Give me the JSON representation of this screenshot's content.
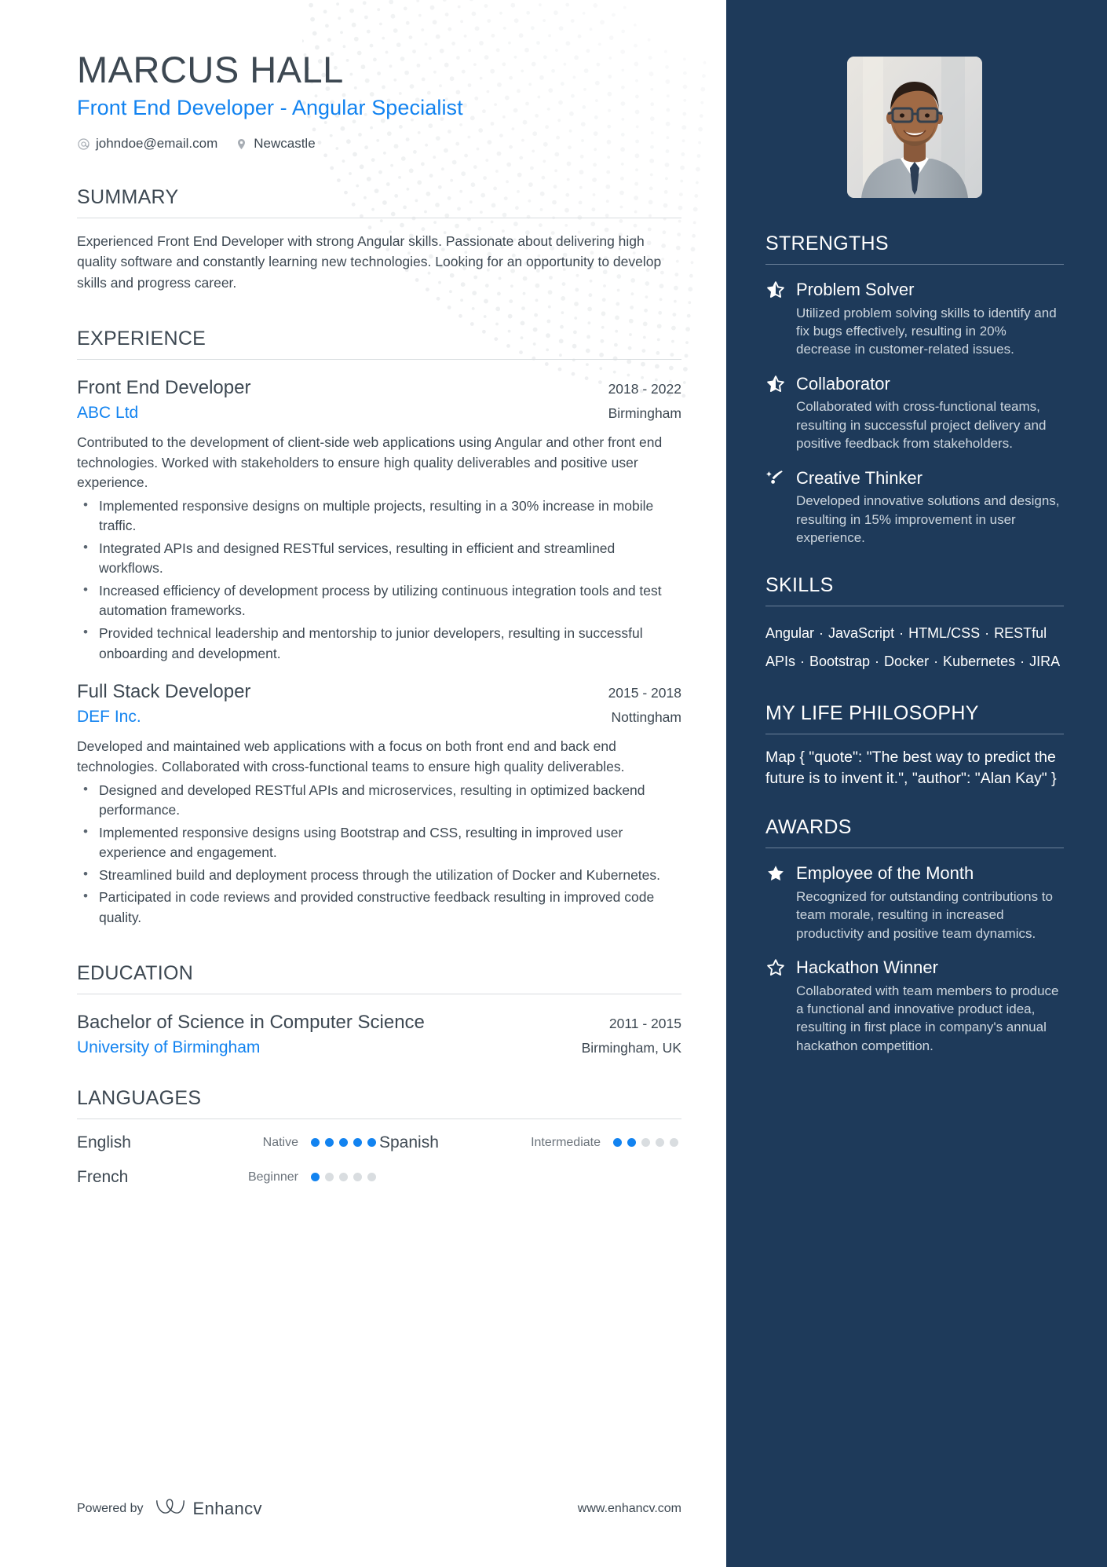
{
  "colors": {
    "accent_blue": "#1283f0",
    "sidebar_bg": "#1e3a5a",
    "text_dark": "#3d4852",
    "muted": "#6b737b",
    "sidebar_body_text": "#cdd6de"
  },
  "header": {
    "name": "MARCUS HALL",
    "job_title": "Front End Developer - Angular Specialist",
    "email": "johndoe@email.com",
    "location": "Newcastle",
    "email_icon": "at-icon",
    "location_icon": "map-pin-icon"
  },
  "summary": {
    "heading": "SUMMARY",
    "text": "Experienced Front End Developer with strong Angular skills. Passionate about delivering high quality software and constantly learning new technologies. Looking for an opportunity to develop skills and progress career."
  },
  "experience": {
    "heading": "EXPERIENCE",
    "entries": [
      {
        "role": "Front End Developer",
        "dates": "2018 - 2022",
        "organization": "ABC Ltd",
        "location": "Birmingham",
        "description": "Contributed to the development of client-side web applications using Angular and other front end technologies. Worked with stakeholders to ensure high quality deliverables and positive user experience.",
        "bullets": [
          "Implemented responsive designs on multiple projects, resulting in a 30% increase in mobile traffic.",
          "Integrated APIs and designed RESTful services, resulting in efficient and streamlined workflows.",
          "Increased efficiency of development process by utilizing continuous integration tools and test automation frameworks.",
          "Provided technical leadership and mentorship to junior developers, resulting in successful onboarding and development."
        ]
      },
      {
        "role": "Full Stack Developer",
        "dates": "2015 - 2018",
        "organization": "DEF Inc.",
        "location": "Nottingham",
        "description": "Developed and maintained web applications with a focus on both front end and back end technologies. Collaborated with cross-functional teams to ensure high quality deliverables.",
        "bullets": [
          "Designed and developed RESTful APIs and microservices, resulting in optimized backend performance.",
          "Implemented responsive designs using Bootstrap and CSS, resulting in improved user experience and engagement.",
          "Streamlined build and deployment process through the utilization of Docker and Kubernetes.",
          "Participated in code reviews and provided constructive feedback resulting in improved code quality."
        ]
      }
    ]
  },
  "education": {
    "heading": "EDUCATION",
    "entries": [
      {
        "degree": "Bachelor of Science in Computer Science",
        "dates": "2011 - 2015",
        "school": "University of Birmingham",
        "location": "Birmingham, UK"
      }
    ]
  },
  "languages": {
    "heading": "LANGUAGES",
    "items": [
      {
        "name": "English",
        "level": "Native",
        "rating": 5,
        "max": 5
      },
      {
        "name": "Spanish",
        "level": "Intermediate",
        "rating": 2,
        "max": 5
      },
      {
        "name": "French",
        "level": "Beginner",
        "rating": 1,
        "max": 5
      }
    ]
  },
  "footer": {
    "powered_by": "Powered by",
    "brand": "Enhancv",
    "website": "www.enhancv.com",
    "logo_icon": "enhancv-logo-icon"
  },
  "sidebar": {
    "photo_icon": "profile-photo",
    "strengths": {
      "heading": "STRENGTHS",
      "items": [
        {
          "title": "Problem Solver",
          "icon": "star-half-icon",
          "description": "Utilized problem solving skills to identify and fix bugs effectively, resulting in 20% decrease in customer-related issues."
        },
        {
          "title": "Collaborator",
          "icon": "star-half-icon",
          "description": "Collaborated with cross-functional teams, resulting in successful project delivery and positive feedback from stakeholders."
        },
        {
          "title": "Creative Thinker",
          "icon": "shooting-star-icon",
          "description": "Developed innovative solutions and designs, resulting in 15% improvement in user experience."
        }
      ]
    },
    "skills": {
      "heading": "SKILLS",
      "items": [
        "Angular",
        "JavaScript",
        "HTML/CSS",
        "RESTful APIs",
        "Bootstrap",
        "Docker",
        "Kubernetes",
        "JIRA"
      ],
      "text": "Angular · JavaScript · HTML/CSS · RESTful APIs · Bootstrap · Docker · Kubernetes · JIRA"
    },
    "philosophy": {
      "heading": "MY LIFE PHILOSOPHY",
      "text": "Map { \"quote\": \"The best way to predict the future is to invent it.\", \"author\": \"Alan Kay\" }"
    },
    "awards": {
      "heading": "AWARDS",
      "items": [
        {
          "title": "Employee of the Month",
          "icon": "star-filled-icon",
          "description": "Recognized for outstanding contributions to team morale, resulting in increased productivity and positive team dynamics."
        },
        {
          "title": "Hackathon Winner",
          "icon": "star-outline-icon",
          "description": "Collaborated with team members to produce a functional and innovative product idea, resulting in first place in company's annual hackathon competition."
        }
      ]
    }
  }
}
